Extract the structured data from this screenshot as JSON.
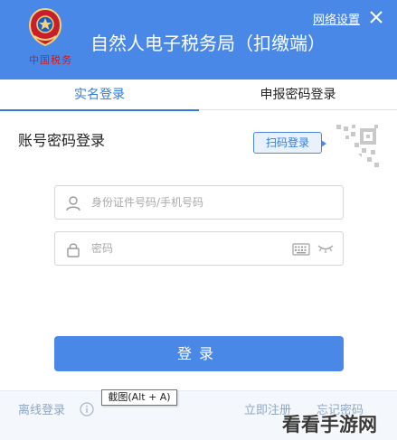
{
  "colors": {
    "brand": "#4a88e8",
    "active_tab": "#2f7bde",
    "emblem_red": "#d01a1a"
  },
  "header": {
    "emblem_icon": "tax-emblem-icon",
    "emblem_script": "中国税务",
    "title": "自然人电子税务局（扣缴端）",
    "network_settings": "网络设置",
    "close_icon": "close-icon"
  },
  "tabs": [
    {
      "label": "实名登录",
      "active": true
    },
    {
      "label": "申报密码登录",
      "active": false
    }
  ],
  "form": {
    "title": "账号密码登录",
    "scan_button": "扫码登录",
    "qr_icon": "qr-code-icon",
    "username": {
      "placeholder": "身份证件号码/手机号码",
      "value": "",
      "icon": "user-icon"
    },
    "password": {
      "placeholder": "密码",
      "value": "",
      "icon": "lock-icon",
      "keyboard_icon": "keyboard-icon",
      "toggle_icon": "eye-closed-icon"
    },
    "login_button": "登录"
  },
  "footer": {
    "offline_login": "离线登录",
    "info_icon": "info-icon",
    "register": "立即注册",
    "forgot_password": "忘记密码"
  },
  "tooltip": "截图(Alt + A)",
  "watermark": "看看手游网"
}
